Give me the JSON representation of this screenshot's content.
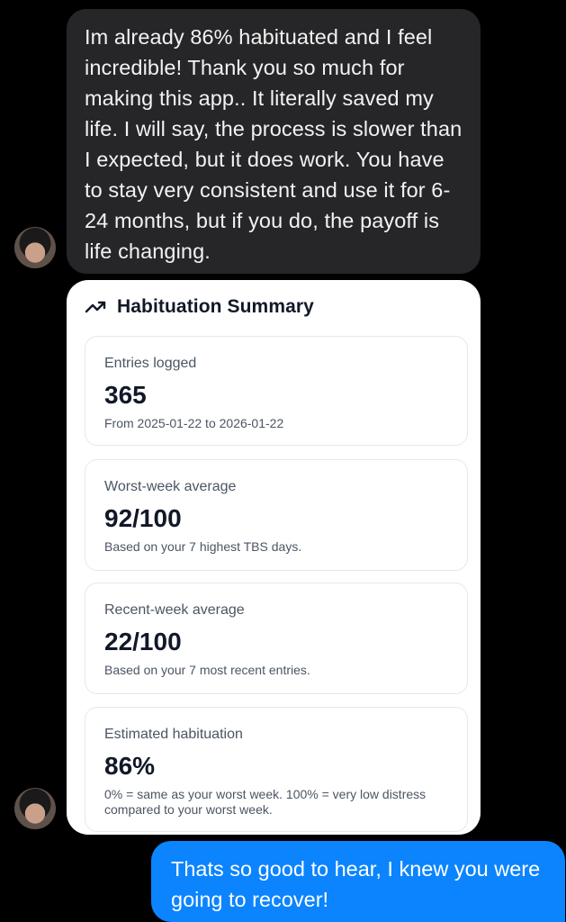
{
  "messages": {
    "incoming_text": "Im already 86% habituated and I feel incredible! Thank you so much for making this app.. It literally saved my life. I will say, the process is slower than I expected, but it does work. You have to stay very consistent and use it for 6-24 months, but if you do, the payoff is life changing.",
    "outgoing_text": "Thats so good to hear, I knew you were going to recover!"
  },
  "summary": {
    "icon": "trend-up-icon",
    "title": "Habituation Summary",
    "stats": [
      {
        "label": "Entries logged",
        "value": "365",
        "note": "From 2025-01-22 to 2026-01-22"
      },
      {
        "label": "Worst-week average",
        "value": "92/100",
        "note": "Based on your 7 highest TBS days."
      },
      {
        "label": "Recent-week average",
        "value": "22/100",
        "note": "Based on your 7 most recent entries."
      },
      {
        "label": "Estimated habituation",
        "value": "86%",
        "note": "0% = same as your worst week. 100% = very low distress compared to your worst week."
      }
    ]
  },
  "colors": {
    "background": "#000000",
    "incoming_bubble": "#262628",
    "outgoing_bubble": "#0b84fe",
    "card": "#ffffff"
  }
}
